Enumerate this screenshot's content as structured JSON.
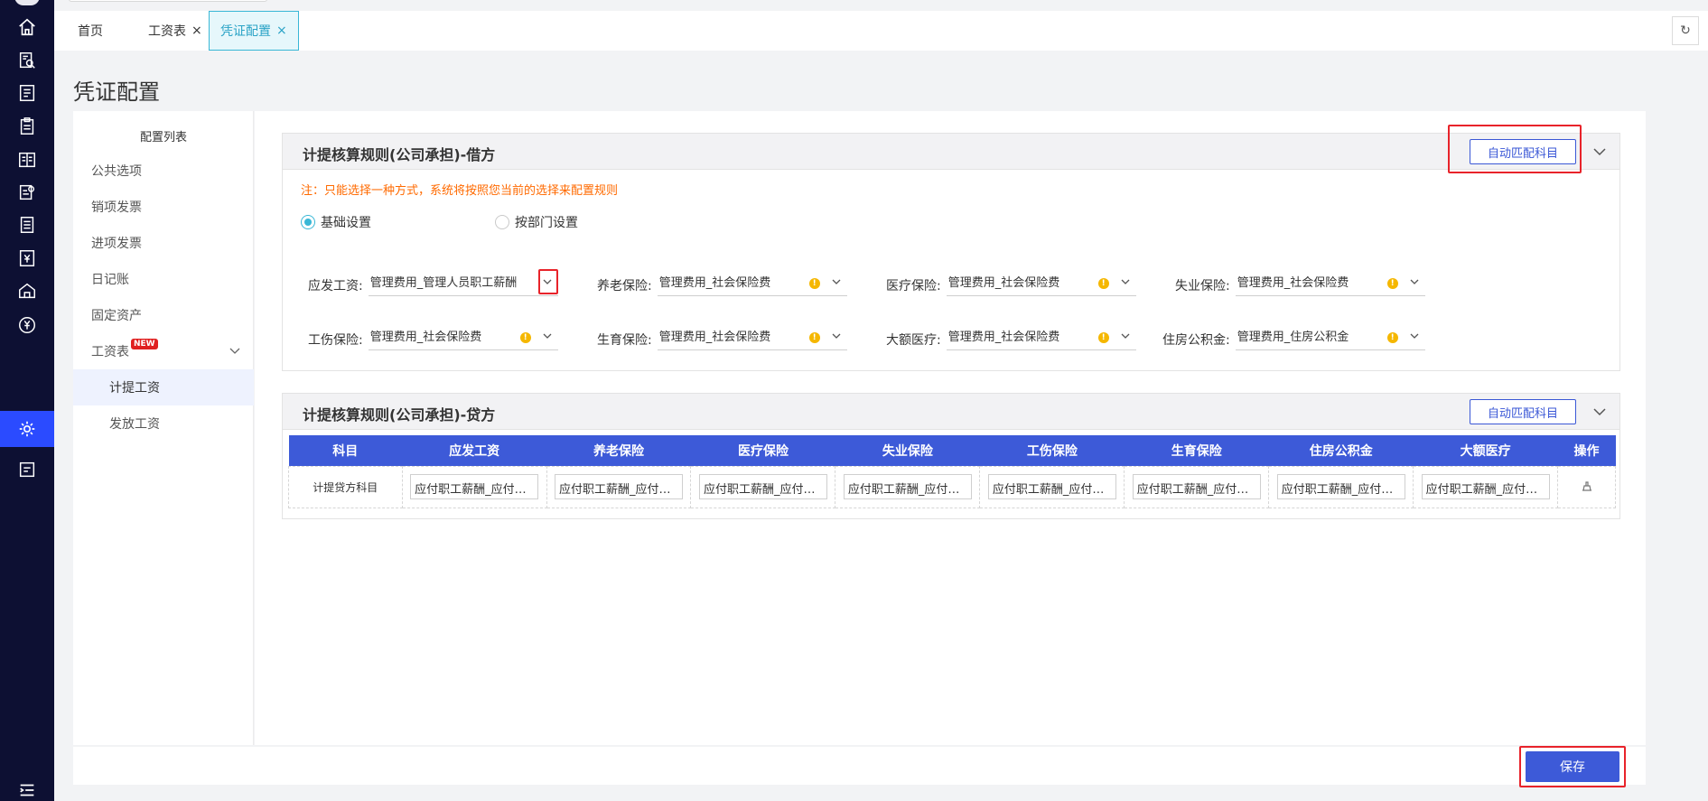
{
  "tabs": [
    {
      "label": "首页",
      "closable": false
    },
    {
      "label": "工资表",
      "closable": true
    },
    {
      "label": "凭证配置",
      "closable": true,
      "active": true
    }
  ],
  "tab_close_glyph": "×",
  "refresh_glyph": "↻",
  "page_title": "凭证配置",
  "sidebar": {
    "title": "配置列表",
    "items": [
      {
        "label": "公共选项"
      },
      {
        "label": "销项发票"
      },
      {
        "label": "进项发票"
      },
      {
        "label": "日记账"
      },
      {
        "label": "固定资产"
      },
      {
        "label": "工资表",
        "badge": "NEW",
        "expanded": true
      },
      {
        "label": "计提工资",
        "selected": true
      },
      {
        "label": "发放工资"
      }
    ]
  },
  "debit_section": {
    "title": "计提核算规则(公司承担)-借方",
    "auto_match_label": "自动匹配科目",
    "note": "注：只能选择一种方式，系统将按照您当前的选择来配置规则",
    "radio_basic": "基础设置",
    "radio_dept": "按部门设置",
    "fields": [
      {
        "label": "应发工资:",
        "value": "管理费用_管理人员职工薪酬"
      },
      {
        "label": "养老保险:",
        "value": "管理费用_社会保险费"
      },
      {
        "label": "医疗保险:",
        "value": "管理费用_社会保险费"
      },
      {
        "label": "失业保险:",
        "value": "管理费用_社会保险费"
      },
      {
        "label": "工伤保险:",
        "value": "管理费用_社会保险费"
      },
      {
        "label": "生育保险:",
        "value": "管理费用_社会保险费"
      },
      {
        "label": "大额医疗:",
        "value": "管理费用_社会保险费"
      },
      {
        "label": "住房公积金:",
        "value": "管理费用_住房公积金"
      }
    ],
    "warn_glyph": "!"
  },
  "credit_section": {
    "title": "计提核算规则(公司承担)-贷方",
    "auto_match_label": "自动匹配科目",
    "columns": [
      "科目",
      "应发工资",
      "养老保险",
      "医疗保险",
      "失业保险",
      "工伤保险",
      "生育保险",
      "住房公积金",
      "大额医疗",
      "操作"
    ],
    "row_label": "计提贷方科目",
    "cells": [
      "应付职工薪酬_应付工资",
      "应付职工薪酬_应付社会保险费",
      "应付职工薪酬_应付社会保险费",
      "应付职工薪酬_应付社会保险费",
      "应付职工薪酬_应付社会保险费",
      "应付职工薪酬_应付社会保险费",
      "应付职工薪酬_应付住房公积金",
      "应付职工薪酬_应付社会保险费"
    ]
  },
  "save_label": "保存",
  "accent": "#3d5ad8",
  "highlight": "#e8232a"
}
